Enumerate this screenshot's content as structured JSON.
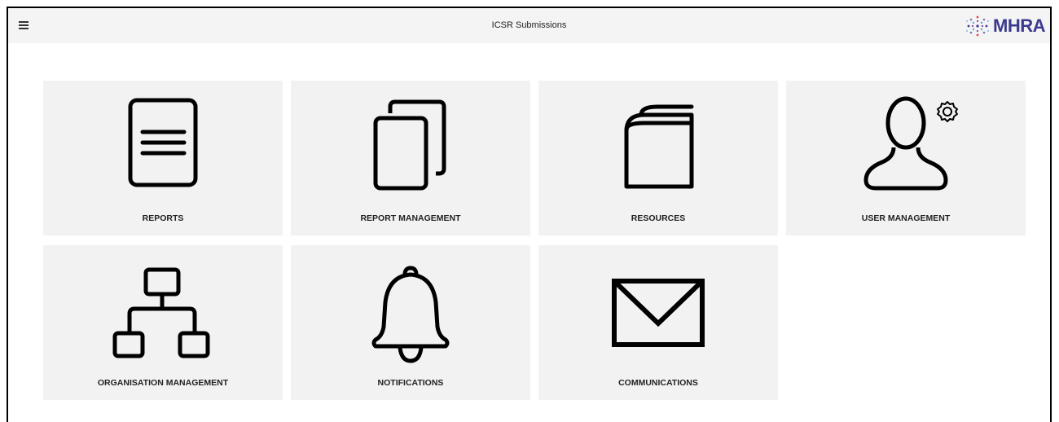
{
  "header": {
    "title": "ICSR Submissions",
    "logo_text": "MHRA"
  },
  "tiles": [
    {
      "label": "REPORTS",
      "icon": "document-icon"
    },
    {
      "label": "REPORT MANAGEMENT",
      "icon": "copy-documents-icon"
    },
    {
      "label": "RESOURCES",
      "icon": "book-icon"
    },
    {
      "label": "USER MANAGEMENT",
      "icon": "user-settings-icon"
    },
    {
      "label": "ORGANISATION MANAGEMENT",
      "icon": "org-chart-icon"
    },
    {
      "label": "NOTIFICATIONS",
      "icon": "bell-icon"
    },
    {
      "label": "COMMUNICATIONS",
      "icon": "envelope-icon"
    }
  ],
  "colors": {
    "tile_bg": "#f2f2f2",
    "topbar_bg": "#f4f4f4",
    "brand": "#3b3a8f"
  }
}
